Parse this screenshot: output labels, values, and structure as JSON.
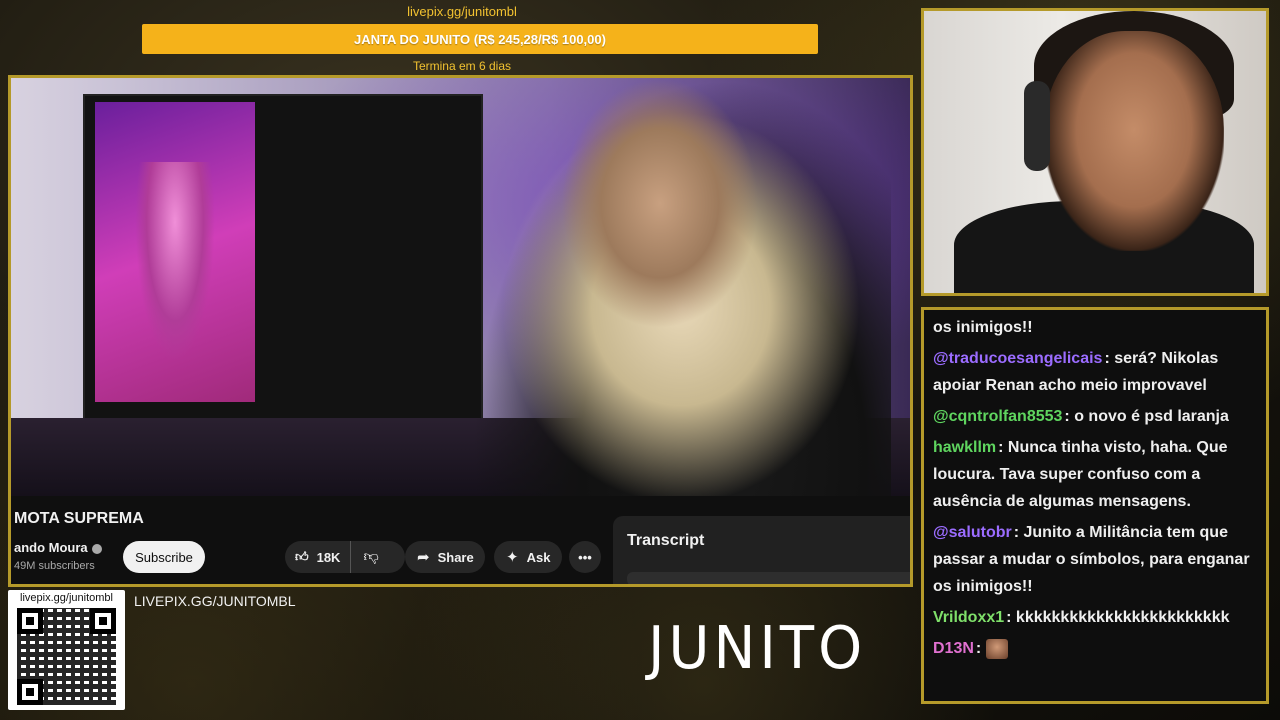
{
  "goal": {
    "url": "livepix.gg/junitombl",
    "title": "JANTA DO JUNITO (R$ 245,28/R$ 100,00)",
    "ends": "Termina em 6 dias",
    "color": "#f5b21a"
  },
  "video": {
    "title": "MOTA SUPREMA",
    "channel": "ando Moura",
    "subscribers": "49M subscribers",
    "subscribe_label": "Subscribe",
    "like_count": "18K",
    "share_label": "Share",
    "ask_label": "Ask",
    "more_label": "•••",
    "transcript_label": "Transcript"
  },
  "chat": {
    "messages": [
      {
        "user": "",
        "color": "#efefef",
        "text": "os inimigos!!"
      },
      {
        "user": "@traducoesangelicais",
        "color": "#9b6cff",
        "text": ": será? Nikolas apoiar Renan acho meio improvavel"
      },
      {
        "user": "@cqntrolfan8553",
        "color": "#5fd55f",
        "text": ": o novo é psd laranja"
      },
      {
        "user": "hawkllm",
        "color": "#5fd55f",
        "text": ": Nunca tinha visto, haha. Que loucura. Tava super confuso com a ausência de algumas mensagens."
      },
      {
        "user": "@salutobr",
        "color": "#9b6cff",
        "text": ": Junito a Militância tem que passar a mudar o símbolos, para enganar os inimigos!!"
      },
      {
        "user": "Vrildoxx1",
        "color": "#7fe06a",
        "text": ": kkkkkkkkkkkkkkkkkkkkkkkk"
      },
      {
        "user": "D13N",
        "color": "#e070d0",
        "text": ":"
      }
    ]
  },
  "qr": {
    "label": "livepix.gg/junitombl"
  },
  "pix_url": "LIVEPIX.GG/JUNITOMBL",
  "logo": "JUNITO",
  "colors": {
    "frame": "#b59a2a",
    "accent": "#f2c230"
  }
}
